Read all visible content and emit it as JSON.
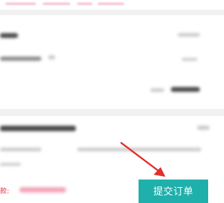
{
  "bottom_bar": {
    "payment_label": "款:",
    "submit_label": "提交订单"
  },
  "colors": {
    "accent_teal": "#1fb0ac",
    "price_red": "#e23a4a",
    "annotation_arrow": "#e0302f"
  },
  "annotation": {
    "icon": "arrow-annotation-icon"
  }
}
